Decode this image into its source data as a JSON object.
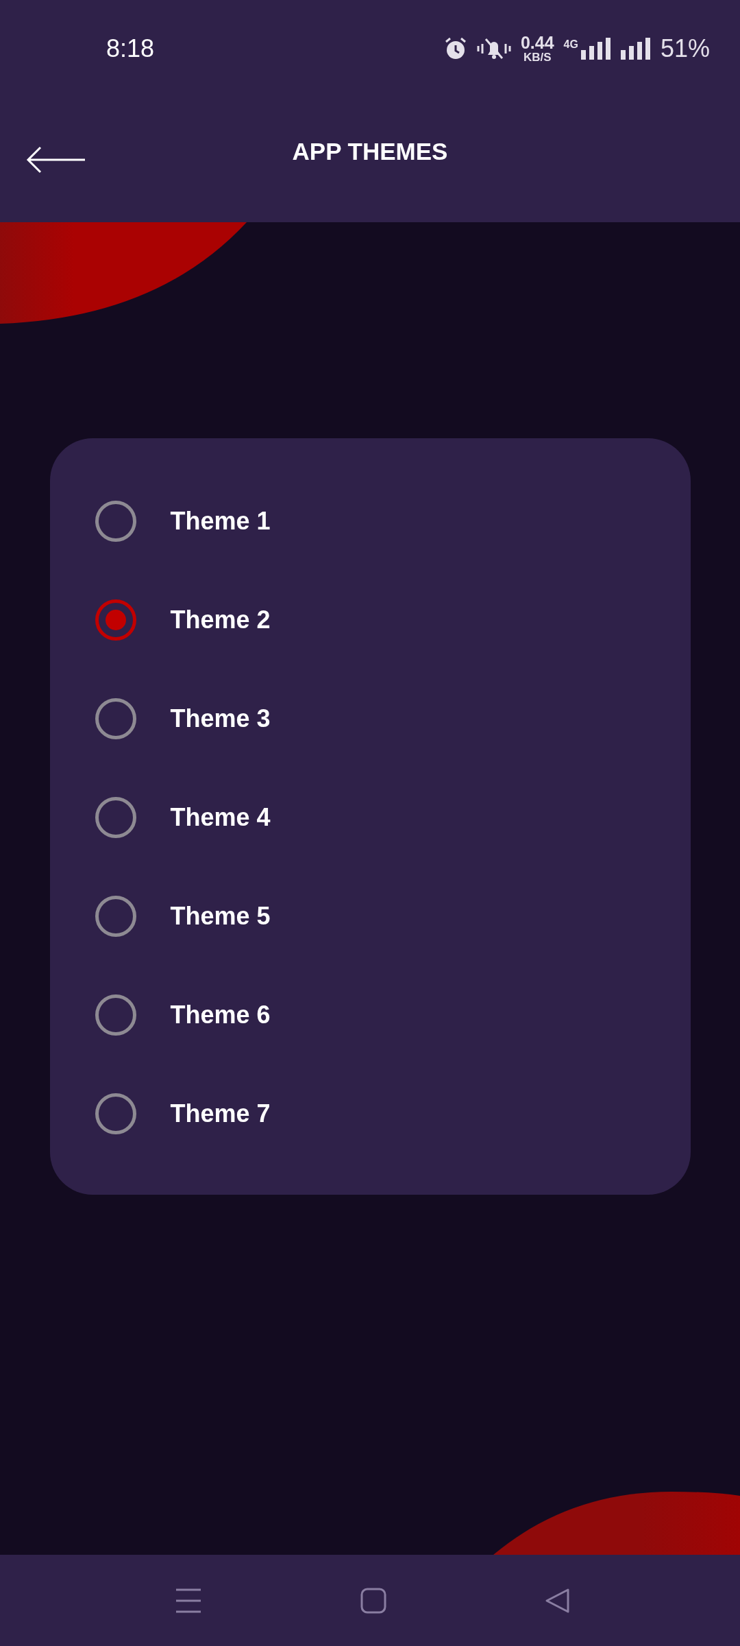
{
  "status_bar": {
    "time": "8:18",
    "speed_value": "0.44",
    "speed_unit": "KB/S",
    "network": "4G",
    "battery": "51%"
  },
  "header": {
    "title": "APP THEMES"
  },
  "themes": [
    {
      "label": "Theme 1",
      "selected": false
    },
    {
      "label": "Theme 2",
      "selected": true
    },
    {
      "label": "Theme 3",
      "selected": false
    },
    {
      "label": "Theme 4",
      "selected": false
    },
    {
      "label": "Theme 5",
      "selected": false
    },
    {
      "label": "Theme 6",
      "selected": false
    },
    {
      "label": "Theme 7",
      "selected": false
    }
  ]
}
